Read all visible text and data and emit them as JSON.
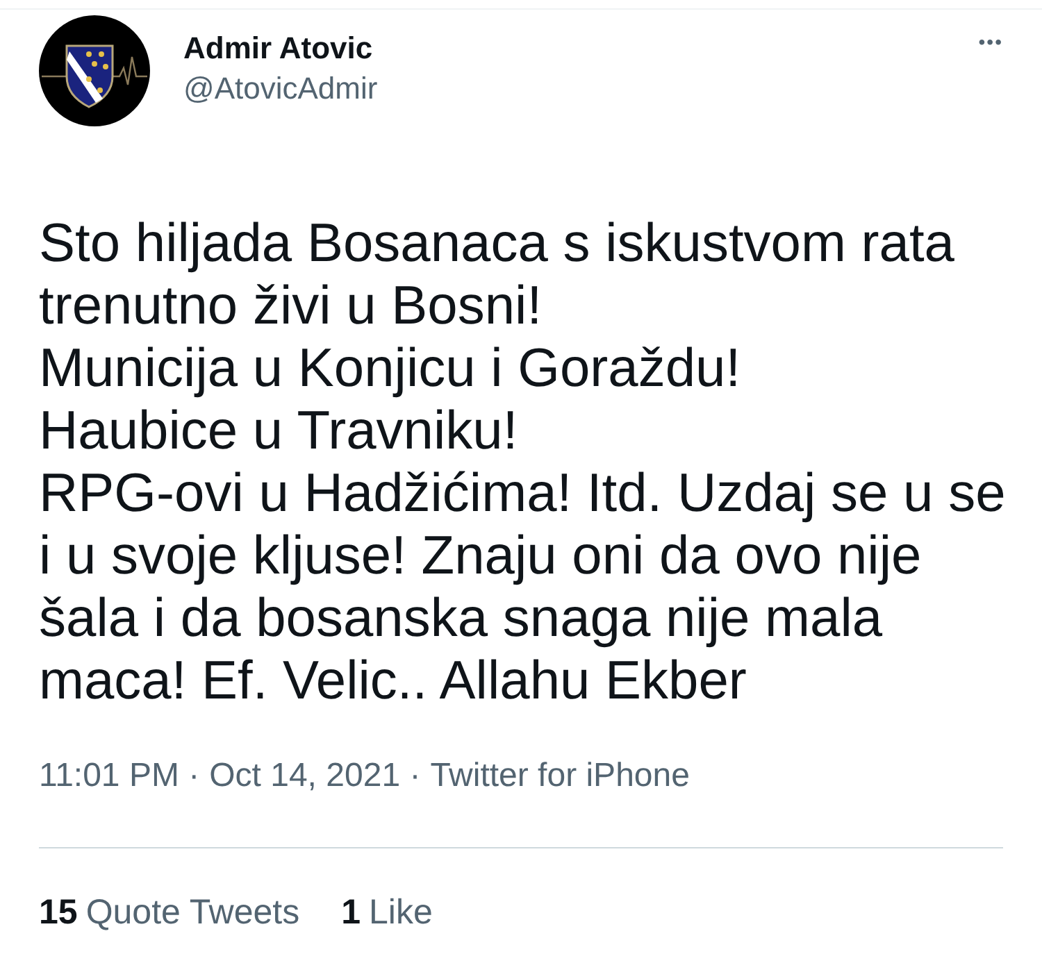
{
  "author": {
    "name": "Admir Atovic",
    "handle": "@AtovicAdmir"
  },
  "menu": "•••",
  "body": [
    "Sto hiljada Bosanaca s iskustvom rata trenutno živi u Bosni!",
    "Municija u Konjicu i Goraždu!",
    "Haubice u Travniku!",
    "RPG-ovi u Hadžićima! Itd. Uzdaj se u se i u svoje kljuse! Znaju oni da ovo nije šala i da bosanska snaga nije mala maca! Ef. Velic.. Allahu Ekber"
  ],
  "meta": {
    "time": "11:01 PM ·",
    "date": "Oct 14, 2021 ·",
    "source": "Twitter for iPhone"
  },
  "stats": [
    {
      "count": "15",
      "label": "Quote Tweets"
    },
    {
      "count": "1",
      "label": "Like"
    }
  ]
}
